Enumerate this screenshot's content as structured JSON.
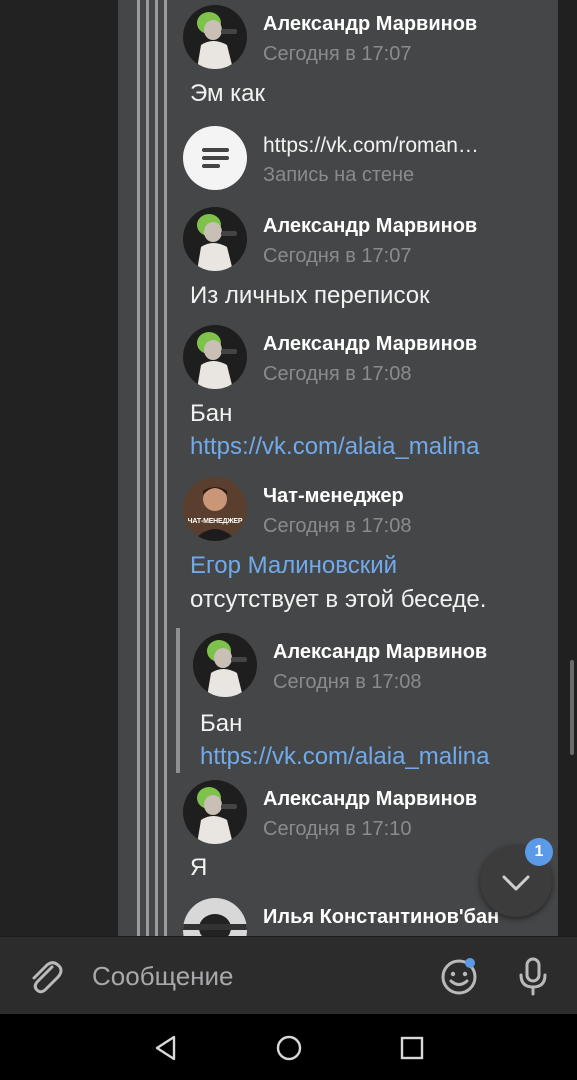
{
  "messages": [
    {
      "author": "Александр Марвинов",
      "time": "Сегодня в 17:07",
      "text": "Эм как"
    },
    {
      "attachment_title": "https://vk.com/roman…",
      "attachment_subtitle": "Запись на стене"
    },
    {
      "author": "Александр Марвинов",
      "time": "Сегодня в 17:07",
      "text": "Из личных переписок"
    },
    {
      "author": "Александр Марвинов",
      "time": "Сегодня в 17:08",
      "text": "Бан",
      "link": "https://vk.com/alaia_malina"
    },
    {
      "author": "Чат-менеджер",
      "avatar_text": "ЧАТ-МЕНЕДЖЕР",
      "time": "Сегодня в 17:08",
      "mention": "Егор Малиновский",
      "text": "отсутствует в этой беседе."
    },
    {
      "author": "Александр Марвинов",
      "time": "Сегодня в 17:08",
      "text": "Бан",
      "link": "https://vk.com/alaia_malina"
    },
    {
      "author": "Александр Марвинов",
      "time": "Сегодня в 17:10",
      "text": "Я"
    },
    {
      "author": "Илья Константинов'бан"
    }
  ],
  "scroll_down": {
    "badge": "1",
    "icon": "chevron-down-icon"
  },
  "composer": {
    "placeholder": "Сообщение",
    "attach_icon": "paperclip-icon",
    "emoji_icon": "smiley-icon",
    "mic_icon": "microphone-icon"
  },
  "navbar": {
    "back_icon": "triangle-back-icon",
    "home_icon": "circle-home-icon",
    "recents_icon": "square-recents-icon"
  },
  "colors": {
    "background": "#454647",
    "link": "#71aaeb",
    "badge": "#5a9ae6"
  }
}
